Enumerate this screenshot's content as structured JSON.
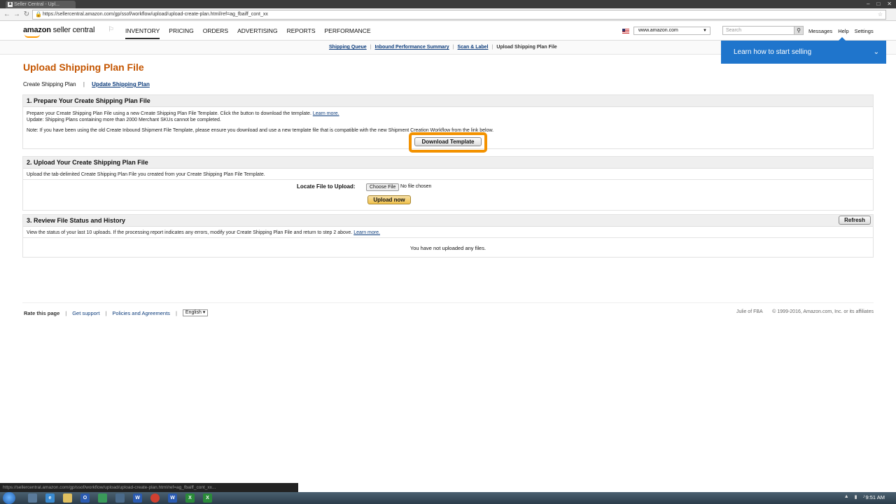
{
  "browser": {
    "tab_title": "Seller Central - Upl...",
    "tab_favicon": "a",
    "url": "https://sellercentral.amazon.com/gp/ssof/workflow/upload/upload-create-plan.html/ref=ag_fbaiff_cont_xx",
    "status_url": "https://sellercentral.amazon.com/gp/ssof/workflow/upload/upload-create-plan.html/ref=ag_fbaiff_cont_xx..."
  },
  "header": {
    "logo_amazon": "amazon",
    "logo_sc": "seller central",
    "nav": [
      "INVENTORY",
      "PRICING",
      "ORDERS",
      "ADVERTISING",
      "REPORTS",
      "PERFORMANCE"
    ],
    "marketplace": "www.amazon.com",
    "search_placeholder": "Search",
    "links": [
      "Messages",
      "Help",
      "Settings"
    ]
  },
  "subnav": {
    "items": [
      "Shipping Queue",
      "Inbound Performance Summary",
      "Scan & Label"
    ],
    "current": "Upload Shipping Plan File"
  },
  "learn_banner": {
    "label": "Learn how to start selling",
    "chevron": "⌄"
  },
  "page": {
    "title": "Upload Shipping Plan File",
    "tab_current": "Create Shipping Plan",
    "tab_sep": "|",
    "tab_other": "Update Shipping Plan"
  },
  "section1": {
    "title": "1. Prepare Your Create Shipping Plan File",
    "line1": "Prepare your Create Shipping Plan File using a new Create Shipping Plan File Template. Click the button to download the template.",
    "learn_more": "Learn more.",
    "line2": "Update: Shipping Plans containing more than 2000 Merchant SKUs cannot be completed.",
    "line3": "Note: If you have been using the old Create Inbound Shipment File Template, please ensure you download and use a new template file that is compatible with the new Shipment Creation Workflow from the link below.",
    "button": "Download Template"
  },
  "section2": {
    "title": "2. Upload Your Create Shipping Plan File",
    "line1": "Upload the tab-delimited Create Shipping Plan File you created from your Create Shipping Plan File Template.",
    "locate_label": "Locate File to Upload:",
    "choose_file": "Choose File",
    "no_file": "No file chosen",
    "upload_button": "Upload now"
  },
  "section3": {
    "title": "3. Review File Status and History",
    "refresh": "Refresh",
    "line1": "View the status of your last 10 uploads. If the processing report indicates any errors, modify your Create Shipping Plan File and return to step 2 above.",
    "learn_more": "Learn more.",
    "empty": "You have not uploaded any files."
  },
  "footer": {
    "rate": "Rate this page",
    "support": "Get support",
    "policies": "Policies and Agreements",
    "language": "English ▾",
    "user": "Julie of FBA",
    "copyright": "© 1999-2016, Amazon.com, Inc. or its affiliates"
  },
  "taskbar": {
    "clock": "9:51 AM"
  },
  "colors": {
    "title": "#c45500",
    "banner": "#1f75cc",
    "highlight": "#f39200",
    "link": "#0a3a7a"
  }
}
